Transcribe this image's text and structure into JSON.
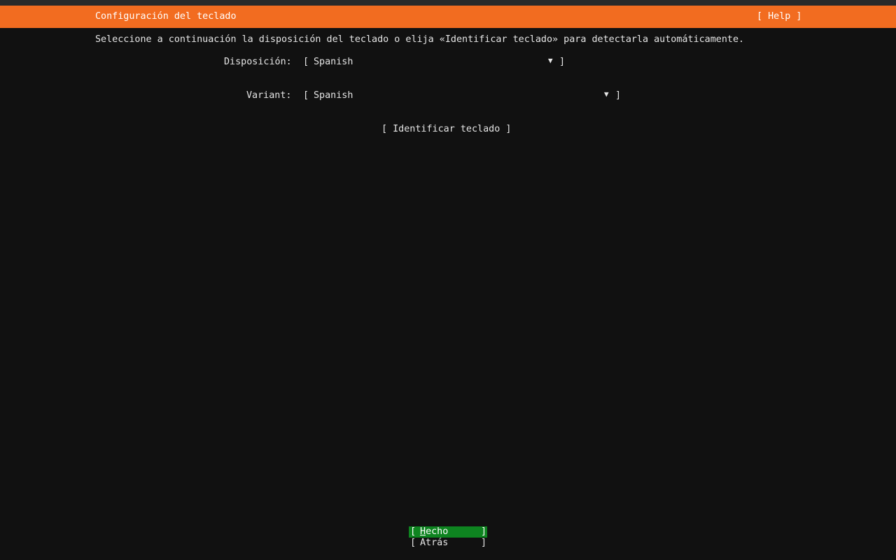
{
  "header": {
    "title": "Configuración del teclado",
    "help_label": "[ Help ]"
  },
  "description": "Seleccione a continuación la disposición del teclado o elija «Identificar teclado» para detectarla automáticamente.",
  "form": {
    "layout_label": "Disposición:",
    "layout_value": "Spanish",
    "variant_label": "Variant:",
    "variant_value": "Spanish",
    "open_bracket": "[",
    "close_bracket": "]",
    "dropdown_arrow": "▼"
  },
  "identify_button": "[ Identificar teclado ]",
  "footer": {
    "done_first": "H",
    "done_rest": "echo",
    "back_label": "Atrás"
  },
  "colors": {
    "header_bg": "#f26c20",
    "focus_bg": "#0e8420",
    "background": "#111111"
  }
}
